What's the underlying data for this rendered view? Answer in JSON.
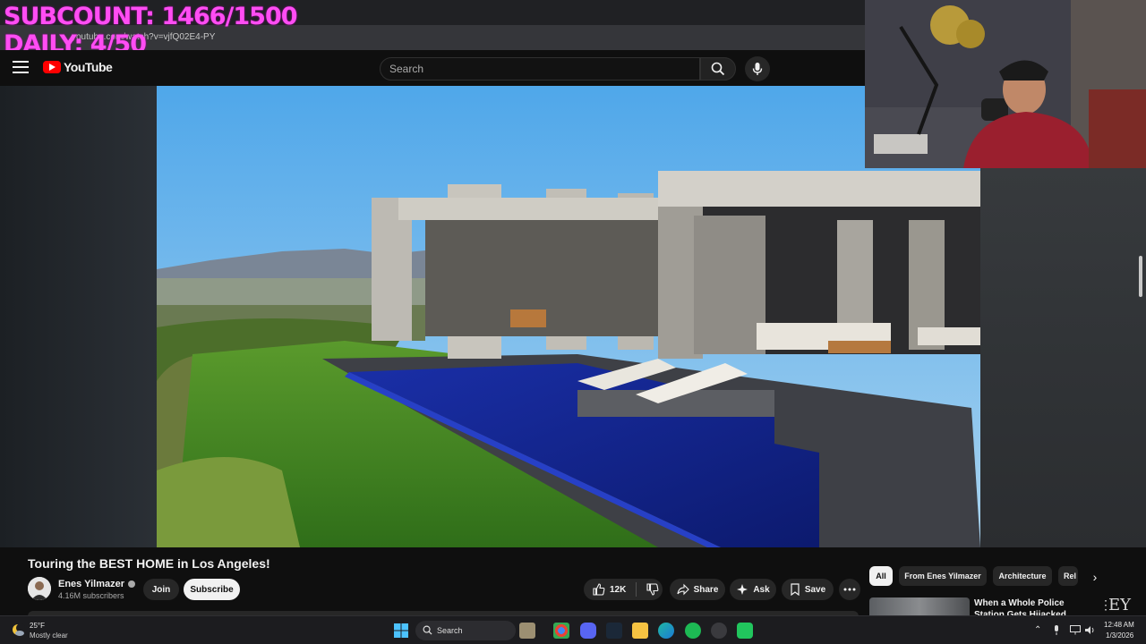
{
  "overlay": {
    "subcount": "SUBCOUNT: 1466/1500",
    "daily": "DAILY: 4/50"
  },
  "browser": {
    "url": "youtube.com/watch?v=vjfQ02E4-PY"
  },
  "youtube": {
    "logo_text": "YouTube",
    "search_placeholder": "Search"
  },
  "video": {
    "title": "Touring the BEST HOME in Los Angeles!",
    "watermark": "EY",
    "channel": {
      "name": "Enes Yilmazer",
      "subscribers": "4.16M subscribers",
      "verified": true
    },
    "join_label": "Join",
    "subscribe_label": "Subscribe",
    "likes": "12K",
    "share_label": "Share",
    "ask_label": "Ask",
    "save_label": "Save"
  },
  "chips": [
    "All",
    "From Enes Yilmazer",
    "Architecture",
    "Rel"
  ],
  "recommendation": {
    "title": "When a Whole Police Station Gets Hijacked"
  },
  "taskbar": {
    "weather_temp": "25°F",
    "weather_desc": "Mostly clear",
    "search_label": "Search",
    "time": "12:48 AM",
    "date": "1/3/2026"
  },
  "colors": {
    "overlay": "#ff4df3",
    "yt_red": "#ff0000",
    "background": "#0f0f0f"
  }
}
